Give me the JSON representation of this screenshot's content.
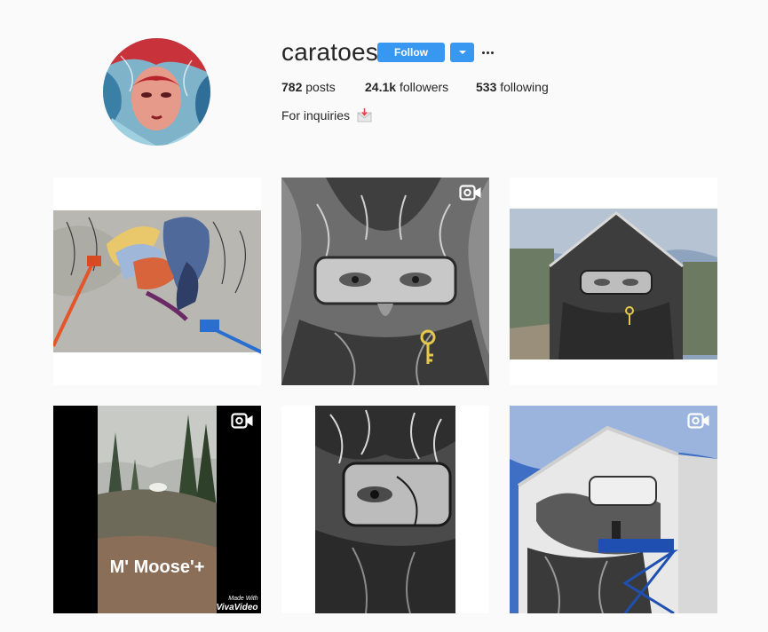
{
  "profile": {
    "username": "caratoes",
    "follow_label": "Follow",
    "stats": {
      "posts_count": "782",
      "posts_label": "posts",
      "followers_count": "24.1k",
      "followers_label": "followers",
      "following_count": "533",
      "following_label": "following"
    },
    "bio_text": "For inquiries",
    "bio_icon": "envelope-icon"
  },
  "posts": [
    {
      "type": "photo",
      "description": "mural"
    },
    {
      "type": "video",
      "badge_icon": "video-icon"
    },
    {
      "type": "album",
      "badge_icon": "multiple-images-icon"
    },
    {
      "type": "video",
      "badge_icon": "video-icon",
      "overlay_text": "M' Moose'+",
      "watermark_line1": "Made With",
      "watermark_line2": "VivaVideo"
    },
    {
      "type": "photo"
    },
    {
      "type": "video",
      "badge_icon": "video-icon"
    }
  ],
  "colors": {
    "accent": "#3897f0",
    "background": "#fafafa",
    "text": "#262626"
  }
}
